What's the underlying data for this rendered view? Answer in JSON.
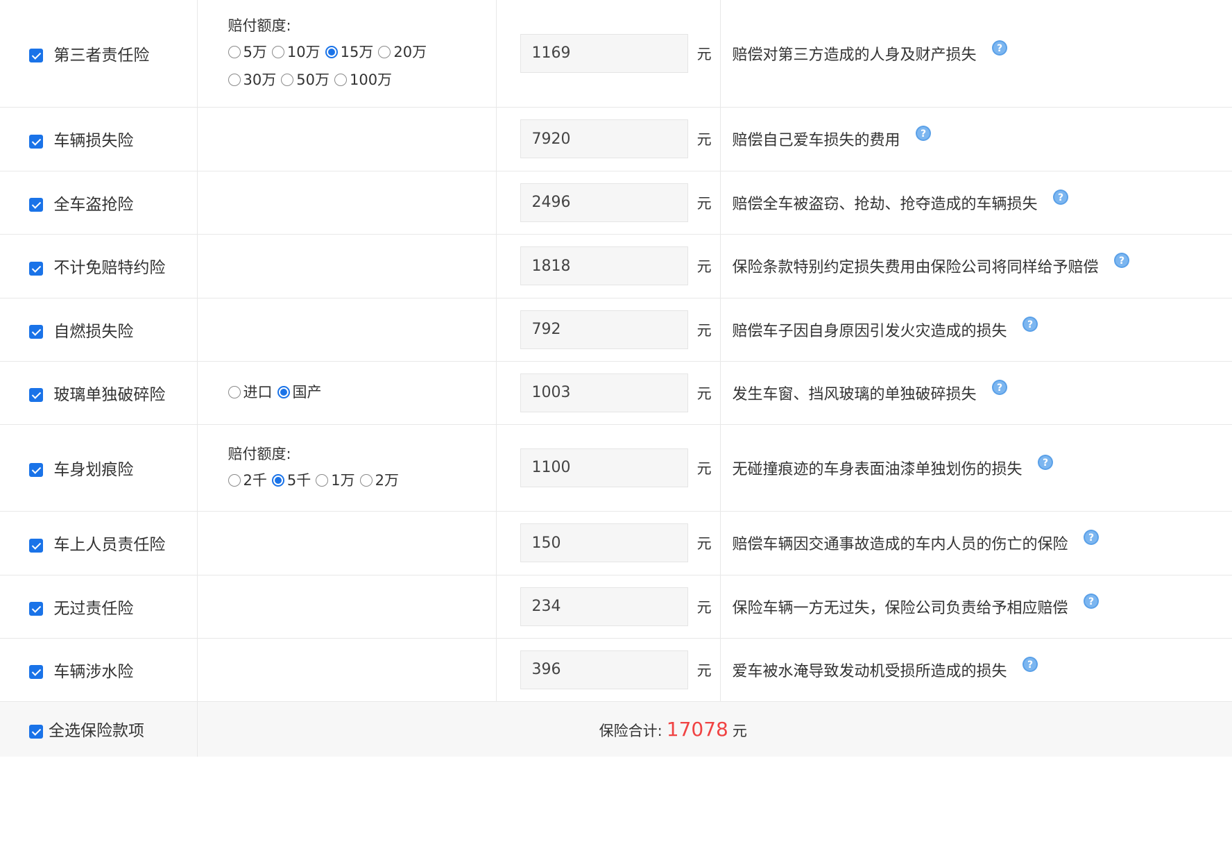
{
  "rows": [
    {
      "name": "第三者责任险",
      "checked": true,
      "option_label": "赔付额度:",
      "options": [
        [
          "5万",
          "10万",
          "15万",
          "20万"
        ],
        [
          "30万",
          "50万",
          "100万"
        ]
      ],
      "selected": "15万",
      "price": "1169",
      "unit": "元",
      "desc": "赔偿对第三方造成的人身及财产损失"
    },
    {
      "name": "车辆损失险",
      "checked": true,
      "price": "7920",
      "unit": "元",
      "desc": "赔偿自己爱车损失的费用"
    },
    {
      "name": "全车盗抢险",
      "checked": true,
      "price": "2496",
      "unit": "元",
      "desc": "赔偿全车被盗窃、抢劫、抢夺造成的车辆损失"
    },
    {
      "name": "不计免赔特约险",
      "checked": true,
      "price": "1818",
      "unit": "元",
      "desc": "保险条款特别约定损失费用由保险公司将同样给予赔偿"
    },
    {
      "name": "自燃损失险",
      "checked": true,
      "price": "792",
      "unit": "元",
      "desc": "赔偿车子因自身原因引发火灾造成的损失"
    },
    {
      "name": "玻璃单独破碎险",
      "checked": true,
      "options": [
        [
          "进口",
          "国产"
        ]
      ],
      "selected": "国产",
      "price": "1003",
      "unit": "元",
      "desc": "发生车窗、挡风玻璃的单独破碎损失"
    },
    {
      "name": "车身划痕险",
      "checked": true,
      "option_label": "赔付额度:",
      "options": [
        [
          "2千",
          "5千",
          "1万",
          "2万"
        ]
      ],
      "selected": "5千",
      "price": "1100",
      "unit": "元",
      "desc": "无碰撞痕迹的车身表面油漆单独划伤的损失"
    },
    {
      "name": "车上人员责任险",
      "checked": true,
      "price": "150",
      "unit": "元",
      "desc": "赔偿车辆因交通事故造成的车内人员的伤亡的保险"
    },
    {
      "name": "无过责任险",
      "checked": true,
      "price": "234",
      "unit": "元",
      "desc": "保险车辆一方无过失，保险公司负责给予相应赔偿"
    },
    {
      "name": "车辆涉水险",
      "checked": true,
      "price": "396",
      "unit": "元",
      "desc": "爱车被水淹导致发动机受损所造成的损失"
    }
  ],
  "footer": {
    "select_all_label": "全选保险款项",
    "select_all_checked": true,
    "total_label": "保险合计:",
    "total_value": "17078",
    "total_unit": "元"
  },
  "colors": {
    "accent": "#1a73e8",
    "total": "#f04343",
    "help_icon": "#5aa0e8"
  }
}
